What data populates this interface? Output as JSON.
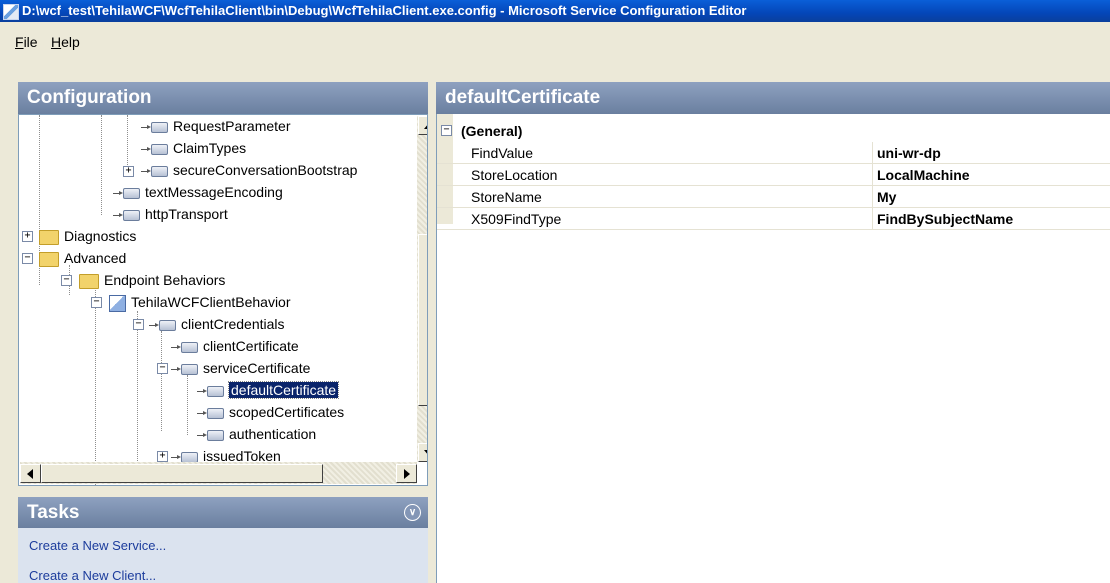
{
  "window": {
    "title": "D:\\wcf_test\\TehilaWCF\\WcfTehilaClient\\bin\\Debug\\WcfTehilaClient.exe.config - Microsoft Service Configuration Editor"
  },
  "menu": {
    "items": [
      {
        "label": "File",
        "accel": "F",
        "rest": "ile"
      },
      {
        "label": "Help",
        "accel": "H",
        "rest": "elp"
      }
    ]
  },
  "configuration": {
    "title": "Configuration",
    "tree": [
      {
        "label": "RequestParameter",
        "icon": "node-icon"
      },
      {
        "label": "ClaimTypes",
        "icon": "node-icon"
      },
      {
        "label": "secureConversationBootstrap",
        "icon": "node-icon"
      },
      {
        "label": "textMessageEncoding",
        "icon": "node-icon"
      },
      {
        "label": "httpTransport",
        "icon": "node-icon"
      },
      {
        "label": "Diagnostics",
        "icon": "folder-icon"
      },
      {
        "label": "Advanced",
        "icon": "folder-icon"
      },
      {
        "label": "Endpoint Behaviors",
        "icon": "folder-icon"
      },
      {
        "label": "TehilaWCFClientBehavior",
        "icon": "behavior-icon"
      },
      {
        "label": "clientCredentials",
        "icon": "node-icon"
      },
      {
        "label": "clientCertificate",
        "icon": "node-icon"
      },
      {
        "label": "serviceCertificate",
        "icon": "node-icon"
      },
      {
        "label": "defaultCertificate",
        "icon": "node-icon",
        "selected": true
      },
      {
        "label": "scopedCertificates",
        "icon": "node-icon"
      },
      {
        "label": "authentication",
        "icon": "node-icon"
      },
      {
        "label": "issuedToken",
        "icon": "node-icon"
      }
    ]
  },
  "tasks": {
    "title": "Tasks",
    "links": [
      "Create a New Service...",
      "Create a New Client..."
    ]
  },
  "properties": {
    "title": "defaultCertificate",
    "category": "(General)",
    "rows": [
      {
        "name": "FindValue",
        "value": "uni-wr-dp"
      },
      {
        "name": "StoreLocation",
        "value": "LocalMachine"
      },
      {
        "name": "StoreName",
        "value": "My"
      },
      {
        "name": "X509FindType",
        "value": "FindBySubjectName"
      }
    ]
  },
  "colors": {
    "title_bar": "#0446b8",
    "panel_header": "#7a8eae",
    "selection": "#0a246a",
    "link": "#1c3c9c"
  }
}
